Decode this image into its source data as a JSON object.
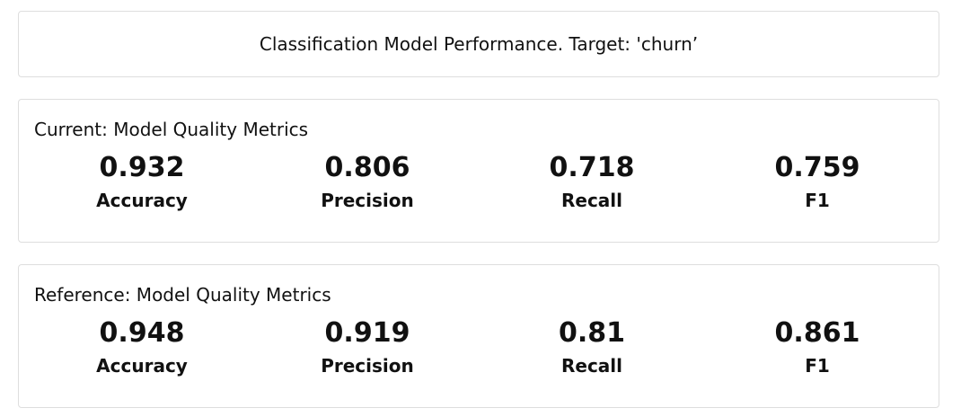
{
  "header": {
    "title": "Classification Model Performance. Target: 'churn’"
  },
  "current": {
    "heading": "Current: Model Quality Metrics",
    "metrics": [
      {
        "value": "0.932",
        "label": "Accuracy"
      },
      {
        "value": "0.806",
        "label": "Precision"
      },
      {
        "value": "0.718",
        "label": "Recall"
      },
      {
        "value": "0.759",
        "label": "F1"
      }
    ]
  },
  "reference": {
    "heading": "Reference: Model Quality Metrics",
    "metrics": [
      {
        "value": "0.948",
        "label": "Accuracy"
      },
      {
        "value": "0.919",
        "label": "Precision"
      },
      {
        "value": "0.81",
        "label": "Recall"
      },
      {
        "value": "0.861",
        "label": "F1"
      }
    ]
  },
  "colors": {
    "border": "#dedede",
    "text": "#111111",
    "background": "#ffffff"
  }
}
